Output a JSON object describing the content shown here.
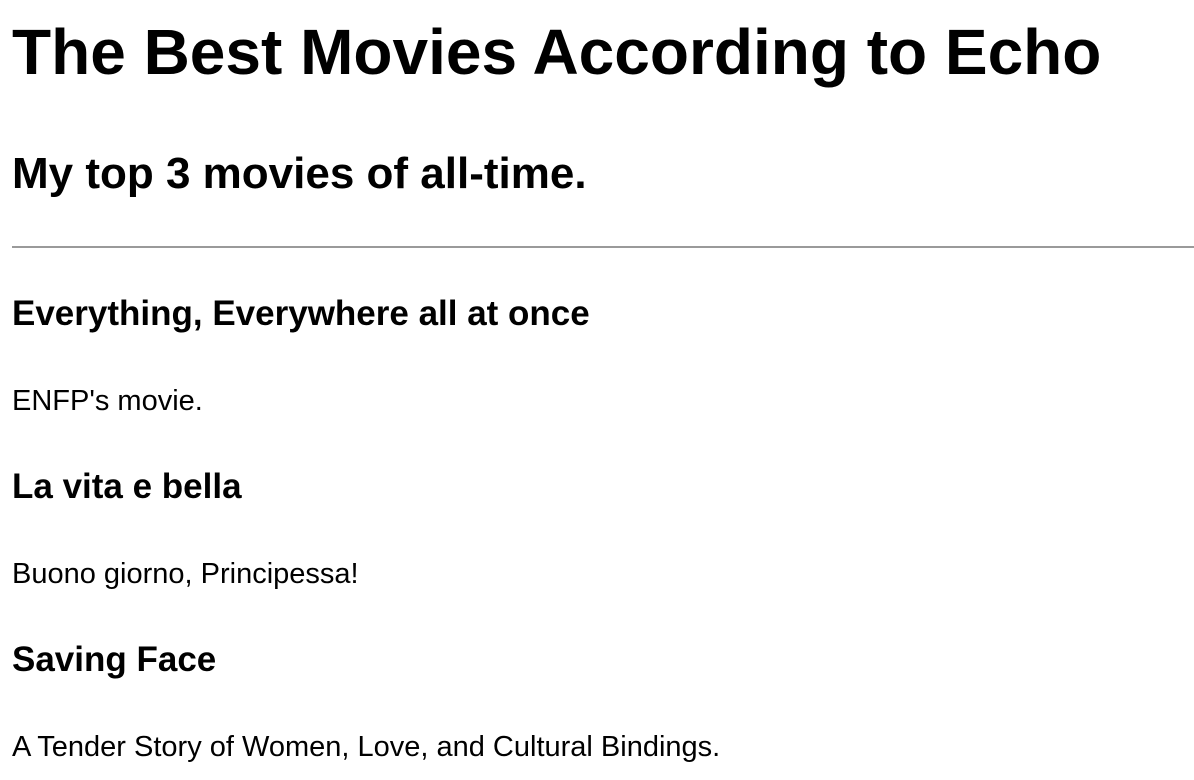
{
  "header": {
    "title": "The Best Movies According to Echo",
    "subtitle": "My top 3 movies of all-time."
  },
  "movies": [
    {
      "title": "Everything, Everywhere all at once",
      "description": "ENFP's movie."
    },
    {
      "title": "La vita e bella",
      "description": "Buono giorno, Principessa!"
    },
    {
      "title": "Saving Face",
      "description": "A Tender Story of Women, Love, and Cultural Bindings."
    }
  ]
}
